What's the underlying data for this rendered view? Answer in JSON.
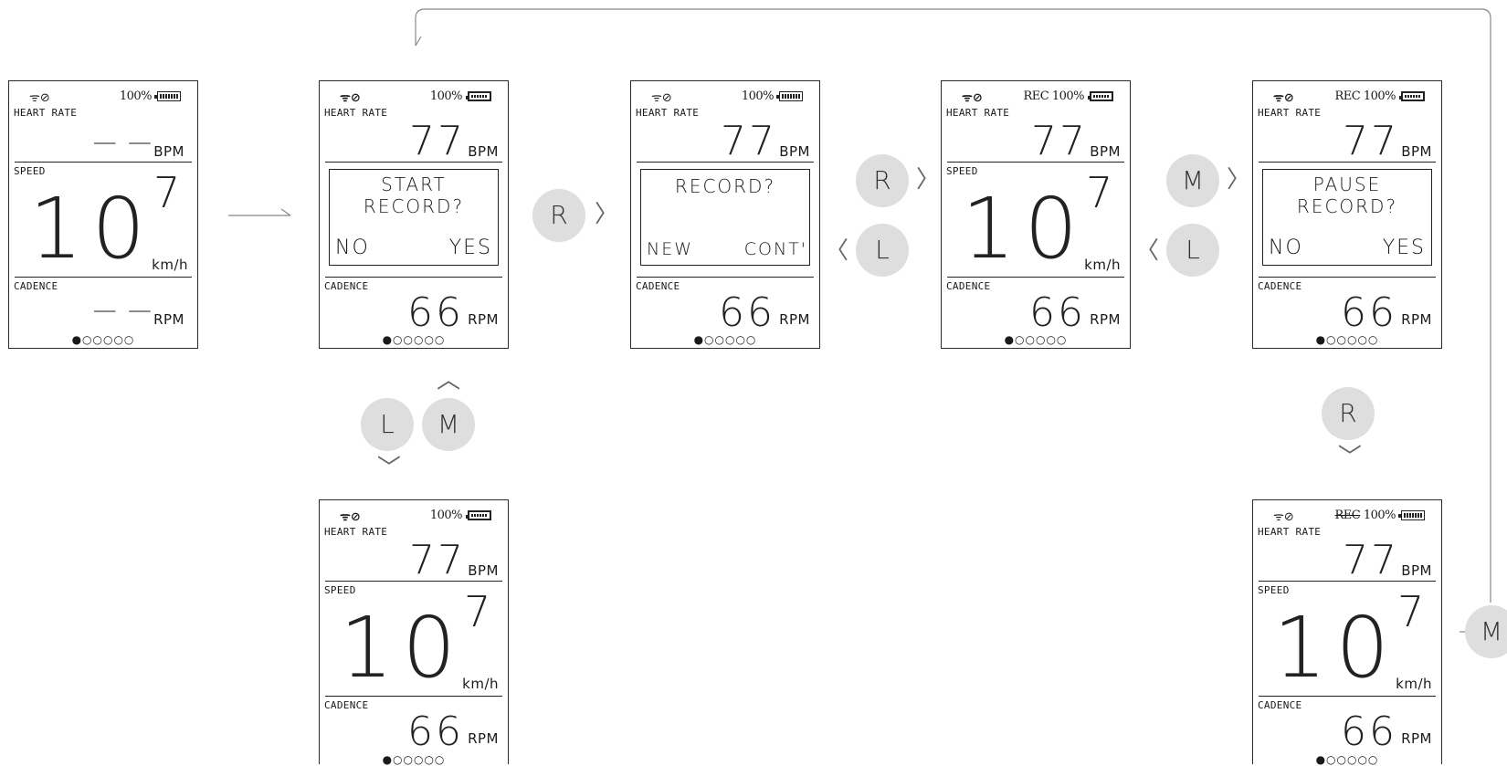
{
  "labels": {
    "heart_rate": "HEART RATE",
    "speed": "SPEED",
    "cadence": "CADENCE",
    "bpm": "BPM",
    "rpm": "RPM",
    "kmh": "km/h",
    "battery_pct": "100%",
    "rec": "REC",
    "page_dots": "●○○○○○",
    "no_hr": "— —",
    "no_cad": "— —"
  },
  "values": {
    "heart_rate": "77",
    "speed_big": "10",
    "speed_small": "7",
    "cadence": "66"
  },
  "dialogs": {
    "start": {
      "line1": "START",
      "line2": "RECORD?",
      "left": "NO",
      "right": "YES"
    },
    "record": {
      "line1": "RECORD?",
      "left": "NEW",
      "right": "CONT'"
    },
    "pause": {
      "line1": "PAUSE",
      "line2": "RECORD?",
      "left": "NO",
      "right": "YES"
    }
  },
  "buttons": {
    "r": "R",
    "l": "L",
    "m": "M"
  },
  "icons": {
    "wifi": "wifi-icon",
    "sensor": "sensor-icon",
    "battery": "battery-icon"
  }
}
